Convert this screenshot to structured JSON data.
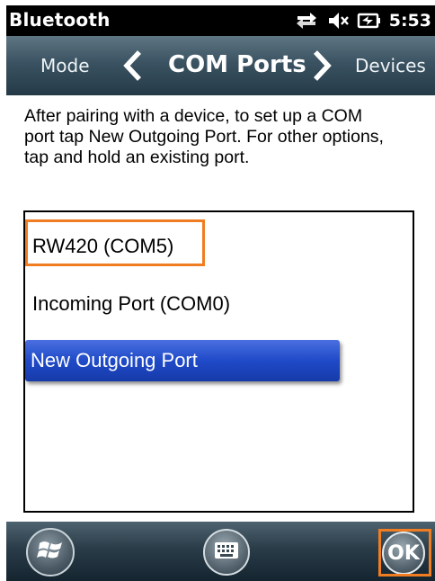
{
  "status_bar": {
    "title": "Bluetooth",
    "time": "5:53",
    "icons": [
      "network-sync-icon",
      "speaker-muted-icon",
      "battery-charging-icon"
    ]
  },
  "header": {
    "prev_label": "Mode",
    "title": "COM Ports",
    "next_label": "Devices"
  },
  "instructions": "After pairing with a device, to set up a COM port tap New Outgoing Port. For other options, tap and hold an existing port.",
  "ports": [
    {
      "label": "RW420 (COM5)",
      "selected": false
    },
    {
      "label": "Incoming Port (COM0)",
      "selected": false
    },
    {
      "label": "New Outgoing Port",
      "selected": true
    }
  ],
  "toolbar": {
    "start_icon": "windows-start-icon",
    "keyboard_icon": "keyboard-icon",
    "ok_label": "OK"
  },
  "colors": {
    "highlight": "#f07d22",
    "selection": "#1f4ac8",
    "header": "#3a5261"
  }
}
